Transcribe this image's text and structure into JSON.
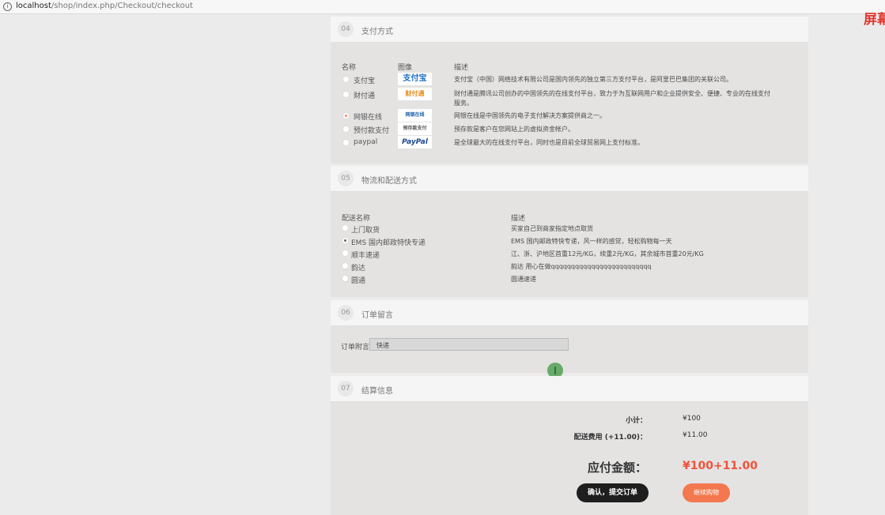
{
  "browser": {
    "url_host": "localhost",
    "url_path": "/shop/index.php/Checkout/checkout",
    "corner_text": "屏幕"
  },
  "payment": {
    "step": "04",
    "title": "支付方式",
    "col_name": "名称",
    "col_image": "图像",
    "col_desc": "描述",
    "methods": [
      {
        "name": "支付宝",
        "logo": "支付宝",
        "desc": "支付宝（中国）网络技术有限公司是国内领先的独立第三方支付平台，是阿里巴巴集团的关联公司。",
        "selected": false
      },
      {
        "name": "财付通",
        "logo": "财付通",
        "desc": "财付通是腾讯公司创办的中国领先的在线支付平台，致力于为互联网用户和企业提供安全、便捷、专业的在线支付",
        "desc2": "服务。",
        "selected": false
      },
      {
        "name": "网银在线",
        "logo": "网银在线",
        "desc": "网银在线是中国领先的电子支付解决方案提供商之一。",
        "selected": true
      },
      {
        "name": "预付款支付",
        "logo": "预存款支付",
        "desc": "预存款是客户在您网站上的虚拟资金帐户。",
        "selected": false
      },
      {
        "name": "paypal",
        "logo": "PayPal",
        "desc": "是全球最大的在线支付平台，同时也是目前全球贸易网上支付标准。",
        "selected": false
      }
    ]
  },
  "shipping": {
    "step": "05",
    "title": "物流和配送方式",
    "col_name": "配送名称",
    "col_desc": "描述",
    "methods": [
      {
        "name": "上门取货",
        "desc": "买家自己到商家指定地点取货",
        "selected": false
      },
      {
        "name": "EMS 国内邮政特快专递",
        "desc": "EMS 国内邮政特快专递，风一样的感觉，轻松购物每一天",
        "selected": true
      },
      {
        "name": "顺丰速递",
        "desc": "江、浙、沪地区首重12元/KG，续重2元/KG，其余城市首重20元/KG",
        "selected": false
      },
      {
        "name": "韵达",
        "desc": "韵达 用心在做qqqqqqqqqqqqqqqqqqqqqqqqq",
        "selected": false
      },
      {
        "name": "圆通",
        "desc": "圆通速递",
        "selected": false
      }
    ]
  },
  "note": {
    "step": "06",
    "title": "订单留言",
    "label": "订单附言",
    "value": "快递"
  },
  "summary": {
    "step": "07",
    "title": "结算信息",
    "subtotal_label": "小计：",
    "subtotal_value": "¥100",
    "shipping_label": "配送费用 (+11.00)：",
    "shipping_value": "¥11.00",
    "total_label": "应付金额：",
    "total_value": "¥100+11.00",
    "submit_label": "确认，提交订单",
    "continue_label": "继续购物"
  },
  "colors": {
    "accent_orange": "#f3784f",
    "total_red": "#f0523a",
    "dark_button": "#1e1e1e"
  }
}
